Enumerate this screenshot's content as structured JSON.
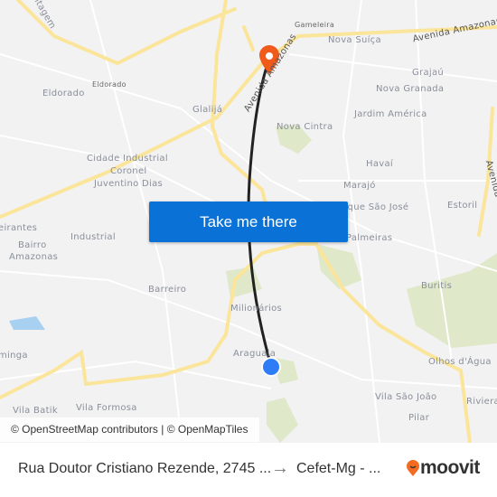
{
  "map": {
    "labels": [
      "ntagem",
      "Gameleira",
      "Avenida Amazonas",
      "Nova Suíça",
      "Grajaú",
      "Nova Granada",
      "Jardim América",
      "Eldorado",
      "Eldorado",
      "Glalijá",
      "Avenida Amazonas",
      "Nova Cintra",
      "Cidade Industrial",
      "Coronel",
      "Juventino Dias",
      "Havaí",
      "Marajó",
      "Parque São José",
      "Estoril",
      "Avenida",
      "eirantes",
      "Industrial",
      "Bairro",
      "Amazonas",
      "Palmeiras",
      "Barreiro",
      "Buritis",
      "Milionários",
      "Araguaia",
      "Olhos d'Água",
      "minga",
      "Vila Formosa",
      "Vila São João",
      "Riviera",
      "Pilar",
      "Vila Batik"
    ],
    "route_color": "#222222",
    "destination_pin_color": "#f05a1a",
    "origin_dot_color": "#2f7df6"
  },
  "cta": {
    "label": "Take me there",
    "color": "#0a72d6"
  },
  "attribution": "© OpenStreetMap contributors | © OpenMapTiles",
  "footer": {
    "origin": "Rua Doutor Cristiano Rezende, 2745 ...",
    "arrow": "→",
    "destination": "Cefet-Mg - ...",
    "brand": "moovit",
    "brand_color": "#f36c21"
  }
}
